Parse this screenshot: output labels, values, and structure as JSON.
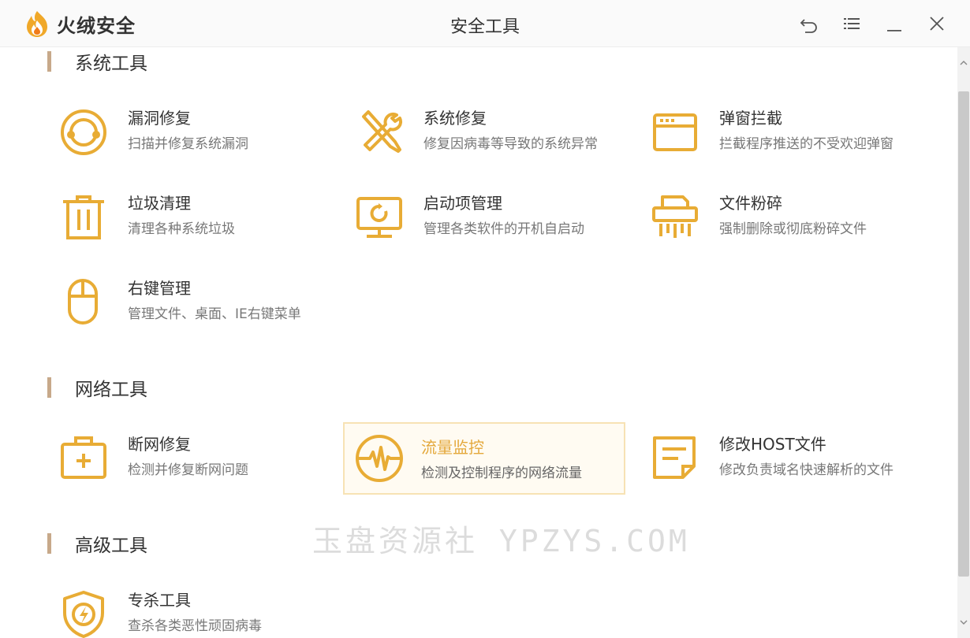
{
  "app": {
    "name": "火绒安全",
    "window_title": "安全工具"
  },
  "sections": {
    "system": {
      "label": "系统工具"
    },
    "network": {
      "label": "网络工具"
    },
    "advanced": {
      "label": "高级工具"
    }
  },
  "tools": {
    "vuln_repair": {
      "name": "漏洞修复",
      "desc": "扫描并修复系统漏洞",
      "icon": "lifebuoy-icon"
    },
    "system_repair": {
      "name": "系统修复",
      "desc": "修复因病毒等导致的系统异常",
      "icon": "tools-icon"
    },
    "popup_block": {
      "name": "弹窗拦截",
      "desc": "拦截程序推送的不受欢迎弹窗",
      "icon": "window-icon"
    },
    "trash_clean": {
      "name": "垃圾清理",
      "desc": "清理各种系统垃圾",
      "icon": "trash-icon"
    },
    "startup_mgr": {
      "name": "启动项管理",
      "desc": "管理各类软件的开机自启动",
      "icon": "monitor-icon"
    },
    "file_shred": {
      "name": "文件粉碎",
      "desc": "强制删除或彻底粉碎文件",
      "icon": "shredder-icon"
    },
    "context_menu": {
      "name": "右键管理",
      "desc": "管理文件、桌面、IE右键菜单",
      "icon": "mouse-icon"
    },
    "net_repair": {
      "name": "断网修复",
      "desc": "检测并修复断网问题",
      "icon": "first-aid-icon"
    },
    "traffic_monitor": {
      "name": "流量监控",
      "desc": "检测及控制程序的网络流量",
      "icon": "pulse-icon"
    },
    "host_edit": {
      "name": "修改HOST文件",
      "desc": "修改负责域名快速解析的文件",
      "icon": "document-icon"
    },
    "special_kill": {
      "name": "专杀工具",
      "desc": "查杀各类恶性顽固病毒",
      "icon": "shield-bolt-icon"
    }
  },
  "watermark": "玉盘资源社 YPZYS.COM",
  "colors": {
    "accent": "#e8ac35",
    "section_bar": "#c7a98a",
    "active_bg": "#fffbf2",
    "active_border": "#f7e2b4"
  }
}
